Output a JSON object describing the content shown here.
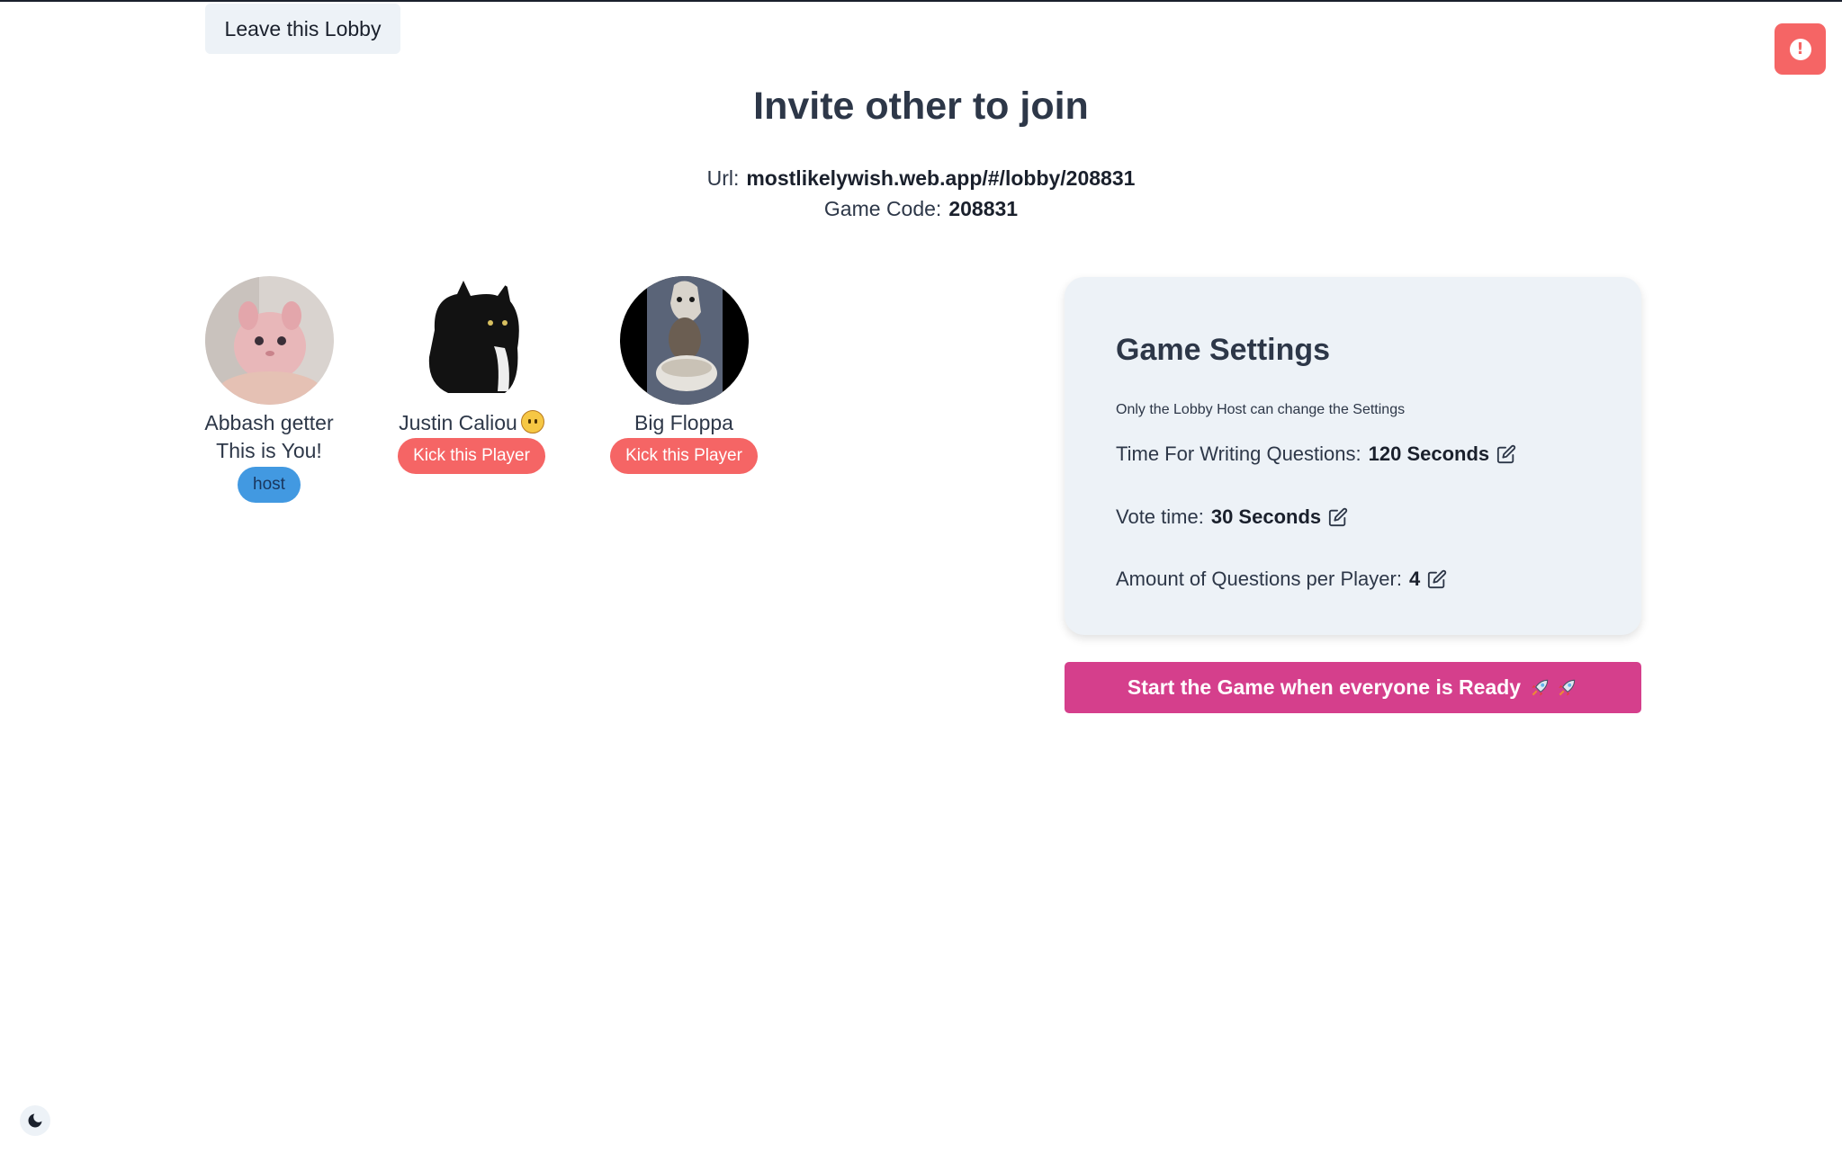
{
  "header": {
    "leave_label": "Leave this Lobby",
    "alert_icon": "alert-circle-icon"
  },
  "invite": {
    "title": "Invite other to join",
    "url_label": "Url:",
    "url_value": "mostlikelywish.web.app/#/lobby/208831",
    "code_label": "Game Code:",
    "code_value": "208831"
  },
  "players": [
    {
      "name": "Abbash getter",
      "subtitle": "This is You!",
      "badge": "host"
    },
    {
      "name": "Justin Caliou",
      "emoji": "face-emoji",
      "action": "Kick this Player"
    },
    {
      "name": "Big Floppa",
      "action": "Kick this Player"
    }
  ],
  "settings": {
    "title": "Game Settings",
    "note": "Only the Lobby Host can change the Settings",
    "items": [
      {
        "label": "Time For Writing Questions:",
        "value": "120 Seconds"
      },
      {
        "label": "Vote time:",
        "value": "30 Seconds"
      },
      {
        "label": "Amount of Questions per Player:",
        "value": "4"
      }
    ]
  },
  "start_label": "Start the Game when everyone is Ready",
  "colors": {
    "accent_pink": "#d53f8c",
    "danger_red": "#f56565",
    "host_blue": "#4299e1",
    "card_bg": "#edf2f7"
  }
}
